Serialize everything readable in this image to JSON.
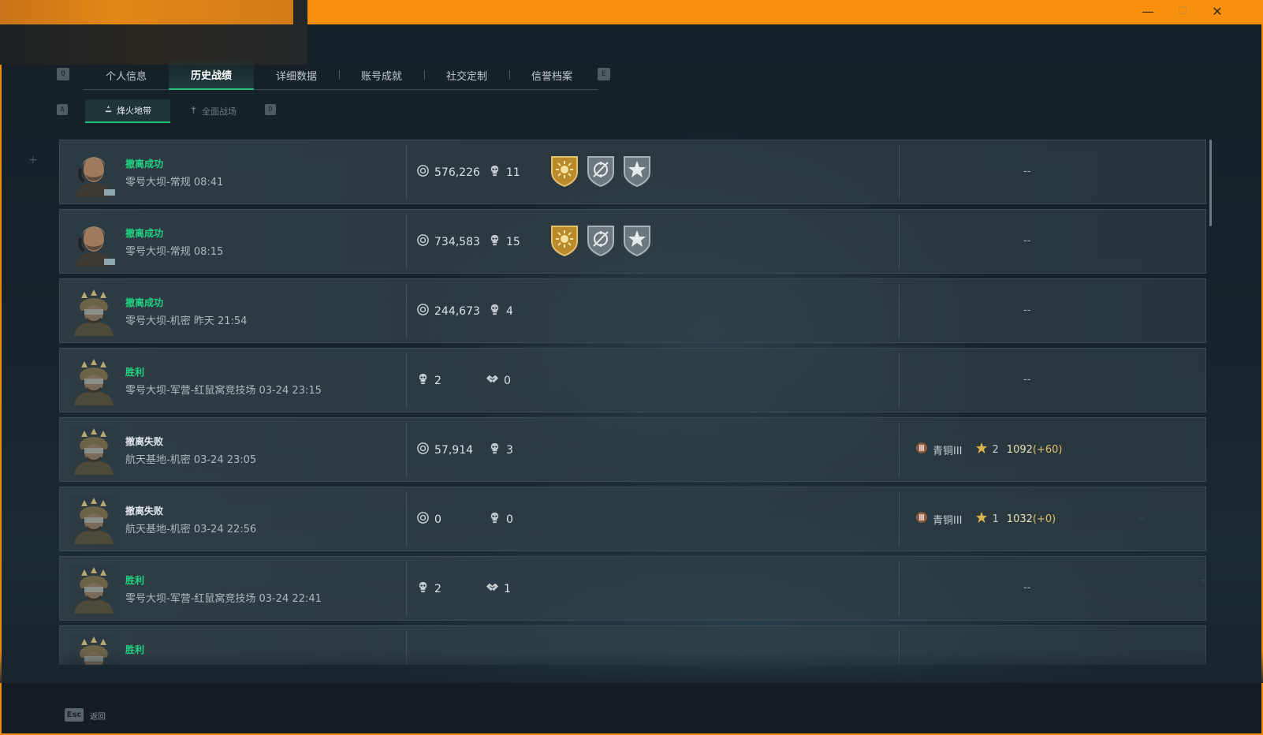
{
  "window": {
    "controls": {
      "minimize": "—",
      "maximize": "☐",
      "close": "✕"
    }
  },
  "keys": {
    "prev_tab": "Q",
    "next_tab": "E",
    "prev_subtab": "A",
    "next_subtab": "D",
    "back": "Esc"
  },
  "tabs": [
    {
      "label": "个人信息",
      "active": false
    },
    {
      "label": "历史战绩",
      "active": true
    },
    {
      "label": "详细数据",
      "active": false
    },
    {
      "label": "账号成就",
      "active": false
    },
    {
      "label": "社交定制",
      "active": false
    },
    {
      "label": "信誉档案",
      "active": false
    }
  ],
  "subtabs": [
    {
      "label": "烽火地带",
      "icon": "warzone-icon",
      "active": true
    },
    {
      "label": "全面战场",
      "icon": "battlefield-icon",
      "active": false
    }
  ],
  "records": [
    {
      "result": "撤离成功",
      "status": "success",
      "avatar": "operator-a",
      "map": "零号大坝-常规 08:41",
      "value": "576,226",
      "kills": "11",
      "medals": [
        "gold-sun-medal",
        "silver-target-medal",
        "silver-star-medal"
      ],
      "rank": null,
      "extra": "--"
    },
    {
      "result": "撤离成功",
      "status": "success",
      "avatar": "operator-a",
      "map": "零号大坝-常规 08:15",
      "value": "734,583",
      "kills": "15",
      "medals": [
        "gold-sun-medal",
        "silver-target-medal",
        "silver-star-medal"
      ],
      "rank": null,
      "extra": "--"
    },
    {
      "result": "撤离成功",
      "status": "success",
      "avatar": "operator-b",
      "map": "零号大坝-机密 昨天 21:54",
      "value": "244,673",
      "kills": "4",
      "medals": [],
      "rank": null,
      "extra": "--"
    },
    {
      "result": "胜利",
      "status": "success",
      "avatar": "operator-b",
      "map": "零号大坝-军营-红鼠窝竞技场 03-24 23:15",
      "kills": "2",
      "assists": "0",
      "medals": [],
      "rank": null,
      "extra": "--"
    },
    {
      "result": "撤离失败",
      "status": "fail",
      "avatar": "operator-b",
      "map": "航天基地-机密 03-24 23:05",
      "value": "57,914",
      "kills": "3",
      "medals": [],
      "rank": {
        "tier": "青铜III",
        "stars": "2",
        "score": "1092",
        "delta": "(+60)"
      }
    },
    {
      "result": "撤离失败",
      "status": "fail",
      "avatar": "operator-b",
      "map": "航天基地-机密 03-24 22:56",
      "value": "0",
      "kills": "0",
      "medals": [],
      "rank": {
        "tier": "青铜III",
        "stars": "1",
        "score": "1032",
        "delta": "(+0)"
      }
    },
    {
      "result": "胜利",
      "status": "success",
      "avatar": "operator-b",
      "map": "零号大坝-军营-红鼠窝竞技场 03-24 22:41",
      "kills": "2",
      "assists": "1",
      "medals": [],
      "rank": null,
      "extra": "--"
    },
    {
      "result": "胜利",
      "status": "success",
      "avatar": "operator-b",
      "map": "",
      "medals": [],
      "rank": null,
      "extra": ""
    }
  ],
  "footer": {
    "back_label": "返回"
  },
  "colors": {
    "accent_green": "#1ec07c",
    "success": "#21d383",
    "titlebar": "#f7900f"
  }
}
